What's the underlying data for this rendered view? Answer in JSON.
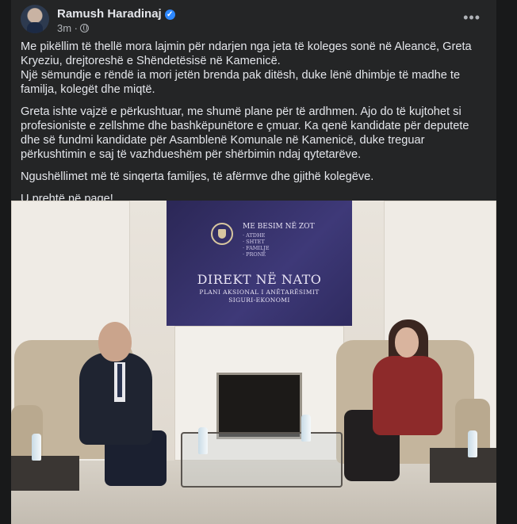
{
  "author": {
    "name": "Ramush Haradinaj",
    "verified_icon": "verified-badge-icon",
    "time": "3m",
    "audience_icon": "globe-icon"
  },
  "more_menu": {
    "label": "•••"
  },
  "post_text": {
    "p1_line1": "Me pikëllim të thellë mora lajmin për ndarjen nga jeta të koleges sonë në Aleancë, Greta Kryeziu, drejtoreshë e Shëndetësisë në Kamenicë.",
    "p1_line2": "Një sëmundje e rëndë ia mori jetën brenda pak ditësh, duke lënë dhimbje të madhe te familja, kolegët dhe miqtë.",
    "p2": "Greta ishte vajzë e përkushtuar, me shumë plane për të ardhmen. Ajo do të kujtohet si profesioniste e zellshme dhe bashkëpunëtore e çmuar. Ka qenë kandidate për deputete dhe së fundmi kandidate për Asamblenë Komunale në Kamenicë, duke treguar përkushtimin e saj të vazhdueshëm për shërbimin ndaj qytetarëve.",
    "p3": "Ngushëllimet më të sinqerta familjes, të afërmve dhe gjithë kolegëve.",
    "p4": "U prehtë në paqe!"
  },
  "photo": {
    "banner_motto": "ME BESIM NË ZOT",
    "banner_values": [
      "· ATDHE",
      "· SHTET",
      "· FAMILJE",
      "· PRONË"
    ],
    "banner_title": "DIREKT NË NATO",
    "banner_sub1": "PLANI AKSIONAL I ANËTARËSIMIT",
    "banner_sub2": "SIGURI-EKONOMI"
  }
}
